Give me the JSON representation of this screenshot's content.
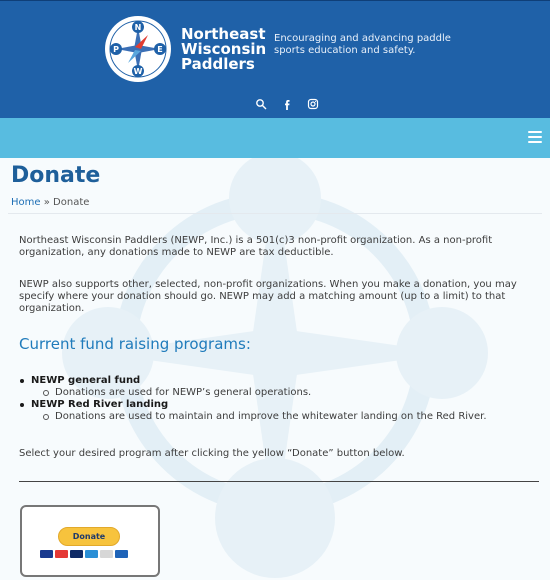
{
  "site": {
    "name_line1": "Northeast",
    "name_line2": "Wisconsin",
    "name_line3": "Paddlers",
    "tagline": "Encouraging and advancing paddle sports education and safety.",
    "compass": {
      "n": "N",
      "p": "P",
      "e": "E",
      "w": "W"
    }
  },
  "header": {
    "icons": [
      "search-icon",
      "facebook-icon",
      "instagram-icon"
    ]
  },
  "page": {
    "title": "Donate",
    "breadcrumb": {
      "home": "Home",
      "sep": "»",
      "current": "Donate"
    },
    "intro_1": "Northeast Wisconsin Paddlers (NEWP, Inc.) is a 501(c)3 non-profit organization.  As a non-profit organization, any donations made to NEWP are tax deductible.",
    "intro_2": "NEWP also supports other, selected, non-profit organizations.  When you make a donation, you may specify where your donation should go.  NEWP may add a matching amount (up to a limit) to that organization.",
    "section_heading": "Current fund raising programs:",
    "programs": [
      {
        "title": "NEWP general fund",
        "detail": "Donations are used for NEWP’s general operations."
      },
      {
        "title": "NEWP Red River landing",
        "detail": "Donations are used to maintain and improve the whitewater landing on the Red River."
      }
    ],
    "instruction": "Select your desired program after clicking the yellow “Donate” button below.",
    "donate_button": "Donate"
  },
  "colors": {
    "header_bg": "#1f61a8",
    "nav_bg": "#58bce0",
    "title": "#1e5f9a",
    "accent": "#f7c33d"
  }
}
